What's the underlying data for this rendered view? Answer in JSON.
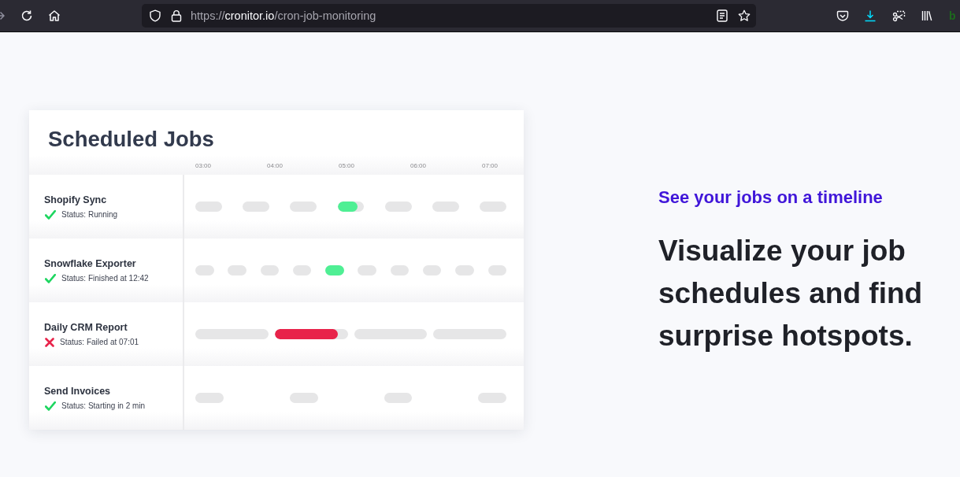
{
  "browser": {
    "url": {
      "scheme": "https://",
      "host": "cronitor.io",
      "path": "/cron-job-monitoring"
    },
    "extension_label": "b"
  },
  "card": {
    "title": "Scheduled Jobs",
    "time_labels": [
      "03:00",
      "04:00",
      "05:00",
      "06:00",
      "07:00"
    ],
    "jobs": [
      {
        "name": "Shopify Sync",
        "failed": false,
        "status_text": "Status: Running",
        "kind": "hourly",
        "runs": [
          {
            "kind": "idle"
          },
          {
            "kind": "idle"
          },
          {
            "kind": "idle"
          },
          {
            "kind": "running",
            "level": 0.76
          },
          {
            "kind": "idle"
          },
          {
            "kind": "idle"
          },
          {
            "kind": "idle"
          }
        ]
      },
      {
        "name": "Snowflake Exporter",
        "failed": false,
        "status_text": "Status: Finished at 12:42",
        "kind": "hourly",
        "runs": [
          {
            "kind": "idle"
          },
          {
            "kind": "idle"
          },
          {
            "kind": "idle"
          },
          {
            "kind": "idle"
          },
          {
            "kind": "done"
          },
          {
            "kind": "idle"
          },
          {
            "kind": "idle"
          },
          {
            "kind": "idle"
          },
          {
            "kind": "idle"
          },
          {
            "kind": "idle"
          }
        ]
      },
      {
        "name": "Daily CRM Report",
        "failed": true,
        "status_text": "Status: Failed at 07:01",
        "kind": "long",
        "runs": [
          {
            "kind": "idle"
          },
          {
            "kind": "failed",
            "level": 0.86
          },
          {
            "kind": "idle"
          },
          {
            "kind": "idle"
          }
        ]
      },
      {
        "name": "Send Invoices",
        "failed": false,
        "status_text": "Status: Starting in 2 min",
        "kind": "sparse",
        "runs": [
          {
            "kind": "idle"
          },
          {
            "kind": "idle"
          },
          {
            "kind": "idle"
          },
          {
            "kind": "idle"
          }
        ]
      }
    ]
  },
  "feature": {
    "eyebrow": "See your jobs on a timeline",
    "headline": "Visualize your job schedules and find surprise hotspots."
  }
}
